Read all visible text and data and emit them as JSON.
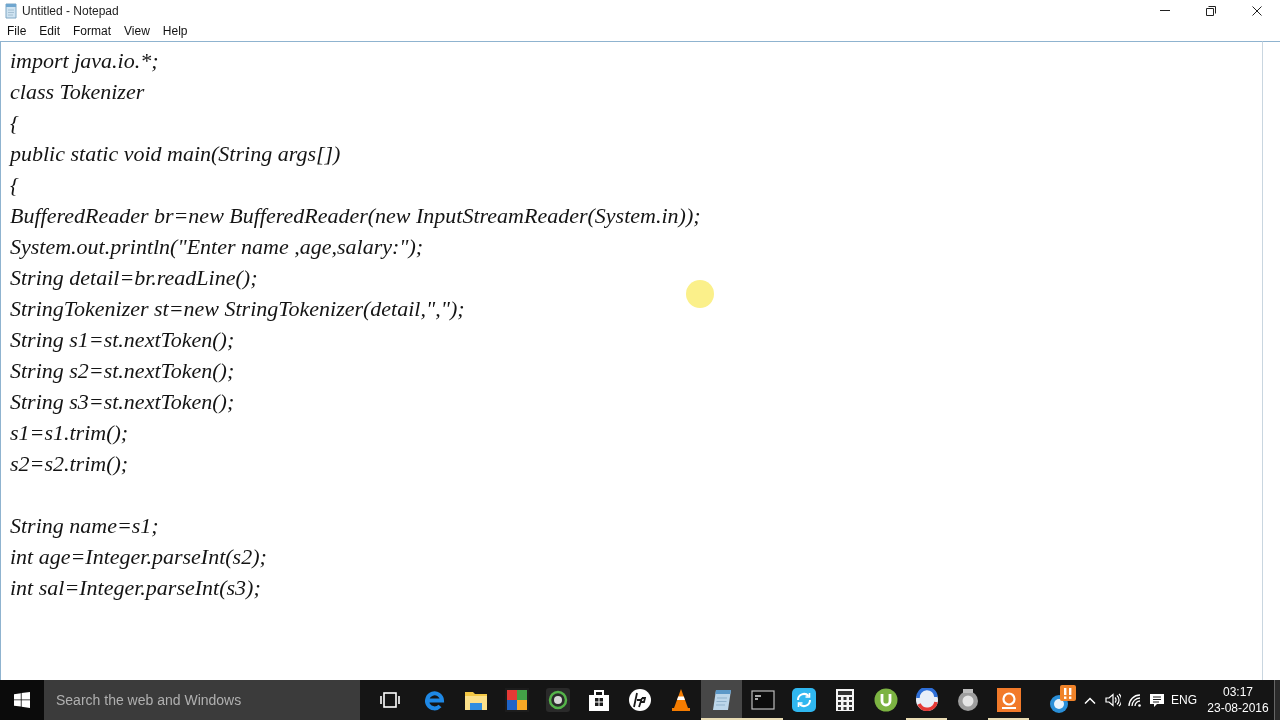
{
  "window": {
    "title": "Untitled - Notepad"
  },
  "menu": [
    "File",
    "Edit",
    "Format",
    "View",
    "Help"
  ],
  "editor": {
    "paragraphs": [
      {
        "lines": [
          "import java.io.*;",
          "class Tokenizer",
          "{",
          "public static void main(String args[])",
          "{",
          "BufferedReader br=new BufferedReader(new InputStreamReader(System.in));",
          "System.out.println(\"Enter name ,age,salary:\");",
          "String detail=br.readLine();",
          "StringTokenizer st=new StringTokenizer(detail,\",\");",
          "String s1=st.nextToken();",
          "String s2=st.nextToken();",
          "String s3=st.nextToken();",
          "s1=s1.trim();",
          "s2=s2.trim();"
        ]
      },
      {
        "lines": [
          "String name=s1;",
          "int age=Integer.parseInt(s2);",
          "int sal=Integer.parseInt(s3);"
        ]
      }
    ]
  },
  "taskbar": {
    "search": {
      "placeholder": "Search the web and Windows"
    },
    "apps": [
      {
        "kind": "browser",
        "running": false,
        "selected": false
      },
      {
        "kind": "folder",
        "running": false,
        "selected": false
      },
      {
        "kind": "mosaic",
        "running": false,
        "selected": false
      },
      {
        "kind": "lens",
        "running": false,
        "selected": false
      },
      {
        "kind": "store",
        "running": false,
        "selected": false
      },
      {
        "kind": "round-logo",
        "running": false,
        "selected": false
      },
      {
        "kind": "cone",
        "running": false,
        "selected": false
      },
      {
        "kind": "notepad",
        "running": true,
        "selected": true
      },
      {
        "kind": "terminal",
        "running": true,
        "selected": false
      },
      {
        "kind": "sync",
        "running": false,
        "selected": false
      },
      {
        "kind": "calculator",
        "running": false,
        "selected": false
      },
      {
        "kind": "u-logo",
        "running": false,
        "selected": false
      },
      {
        "kind": "swirl",
        "running": true,
        "selected": false
      },
      {
        "kind": "gadget",
        "running": false,
        "selected": false
      },
      {
        "kind": "record",
        "running": true,
        "selected": false
      }
    ],
    "tray": {
      "language": "ENG",
      "time": "03:17",
      "date": "23-08-2016"
    }
  }
}
